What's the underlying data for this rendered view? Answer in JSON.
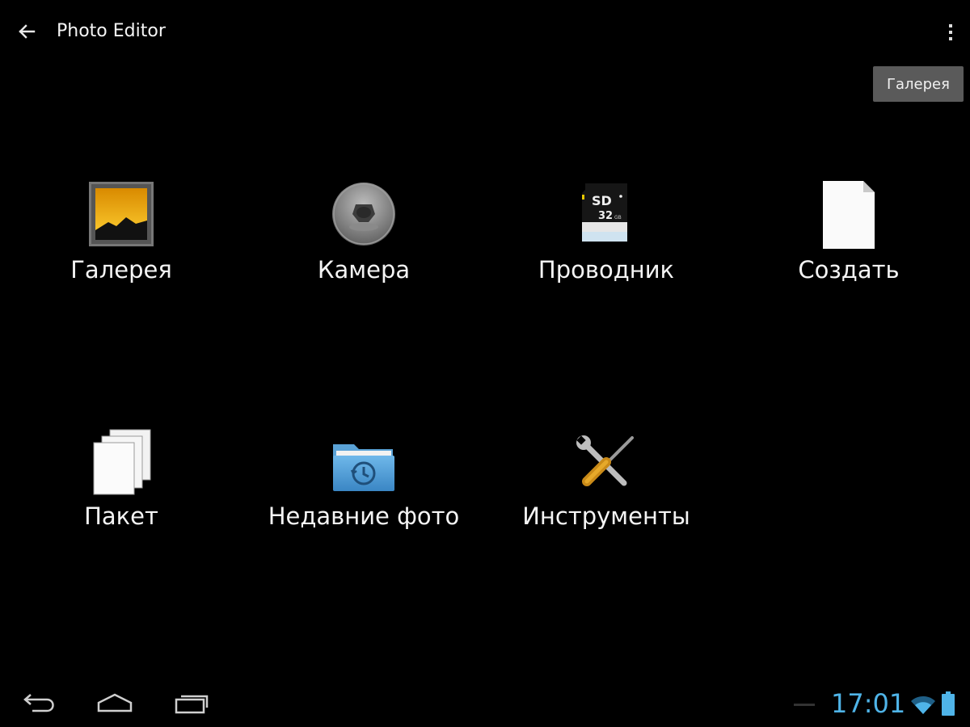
{
  "app": {
    "title": "Photo Editor",
    "back_icon": "back-arrow-icon",
    "menu_icon": "overflow-menu-icon"
  },
  "tooltip": {
    "text": "Галерея"
  },
  "tiles": [
    {
      "label": "Галерея",
      "icon": "gallery-icon"
    },
    {
      "label": "Камера",
      "icon": "camera-icon"
    },
    {
      "label": "Проводник",
      "icon": "sd-card-icon"
    },
    {
      "label": "Создать",
      "icon": "blank-document-icon"
    },
    {
      "label": "Пакет",
      "icon": "stacked-pages-icon"
    },
    {
      "label": "Недавние фото",
      "icon": "recent-folder-icon"
    },
    {
      "label": "Инструменты",
      "icon": "tools-icon"
    }
  ],
  "sd_card": {
    "top_text": "SD",
    "capacity": "32",
    "unit": "GB"
  },
  "nav_bar": {
    "back_icon": "nav-back-icon",
    "home_icon": "nav-home-icon",
    "recents_icon": "nav-recents-icon"
  },
  "status": {
    "time": "17:01",
    "wifi_icon": "wifi-icon",
    "battery_icon": "battery-icon",
    "accent_color": "#4fb4e8"
  }
}
